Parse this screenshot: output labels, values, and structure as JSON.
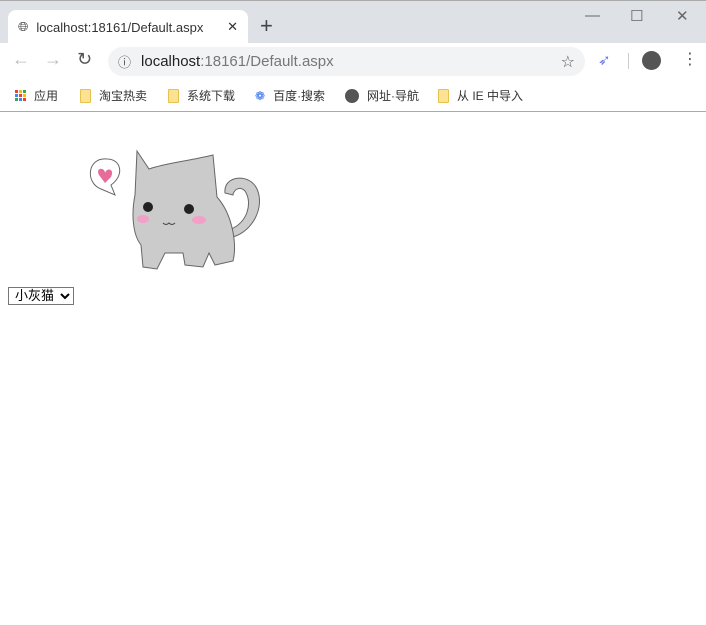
{
  "tab": {
    "title": "localhost:18161/Default.aspx",
    "close": "✕",
    "new": "+"
  },
  "window": {
    "minimize": "—",
    "maximize": "☐",
    "close": "✕"
  },
  "address": {
    "host": "localhost",
    "path": ":18161/Default.aspx"
  },
  "bookmarks": [
    {
      "label": "应用",
      "icon": "apps-icon"
    },
    {
      "label": "淘宝热卖",
      "icon": "folder-icon"
    },
    {
      "label": "系统下载",
      "icon": "folder-icon"
    },
    {
      "label": "百度·搜索",
      "icon": "baidu-paw-icon"
    },
    {
      "label": "网址·导航",
      "icon": "globe-icon"
    },
    {
      "label": "从 IE 中导入",
      "icon": "folder-icon"
    }
  ],
  "page": {
    "select_value": "小灰猫"
  }
}
